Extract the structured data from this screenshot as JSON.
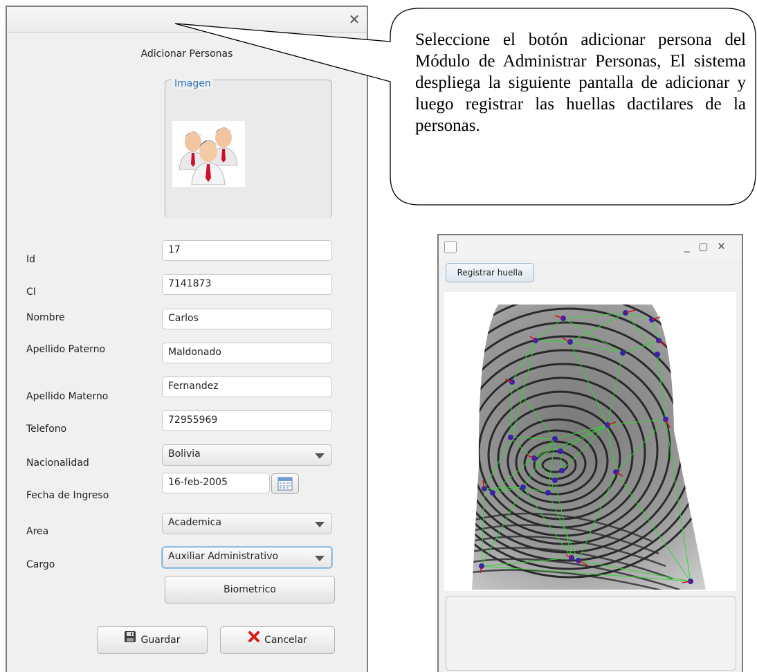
{
  "dialog": {
    "close_glyph": "✕",
    "title": "Adicionar Personas",
    "image_legend": "Imagen",
    "avatar_icon": "people-group-icon",
    "labels": {
      "id": "Id",
      "ci": "CI",
      "nombre": "Nombre",
      "apellido_paterno": "Apellido Paterno",
      "apellido_materno": "Apellido Materno",
      "telefono": "Telefono",
      "nacionalidad": "Nacionalidad",
      "fecha_ingreso": "Fecha de Ingreso",
      "area": "Area",
      "cargo": "Cargo"
    },
    "values": {
      "id": "17",
      "ci": "7141873",
      "nombre": "Carlos",
      "apellido_paterno": "Maldonado",
      "apellido_materno": "Fernandez",
      "telefono": "72955969",
      "nacionalidad": "Bolivia",
      "fecha_ingreso": "16-feb-2005",
      "area": "Academica",
      "cargo": "Auxiliar Administrativo"
    },
    "buttons": {
      "biometrico": "Biometrico",
      "guardar": "Guardar",
      "cancelar": "Cancelar"
    },
    "icons": {
      "save": "floppy-disk-icon",
      "cancel": "red-x-icon",
      "calendar": "calendar-icon",
      "dropdown": "chevron-down-icon"
    }
  },
  "callout": {
    "text": "Seleccione el botón adicionar persona del Módulo de Administrar Personas, El sistema despliega la siguiente pantalla  de adicionar y luego registrar las huellas dactilares de la personas."
  },
  "fingerprint_window": {
    "controls": "_ ▢ ✕",
    "register_button": "Registrar huella",
    "image": "fingerprint-minutiae-image",
    "colors": {
      "minutia": "#3a1fb0",
      "minutia_dir": "#d01010",
      "link": "#2fd62f"
    }
  }
}
